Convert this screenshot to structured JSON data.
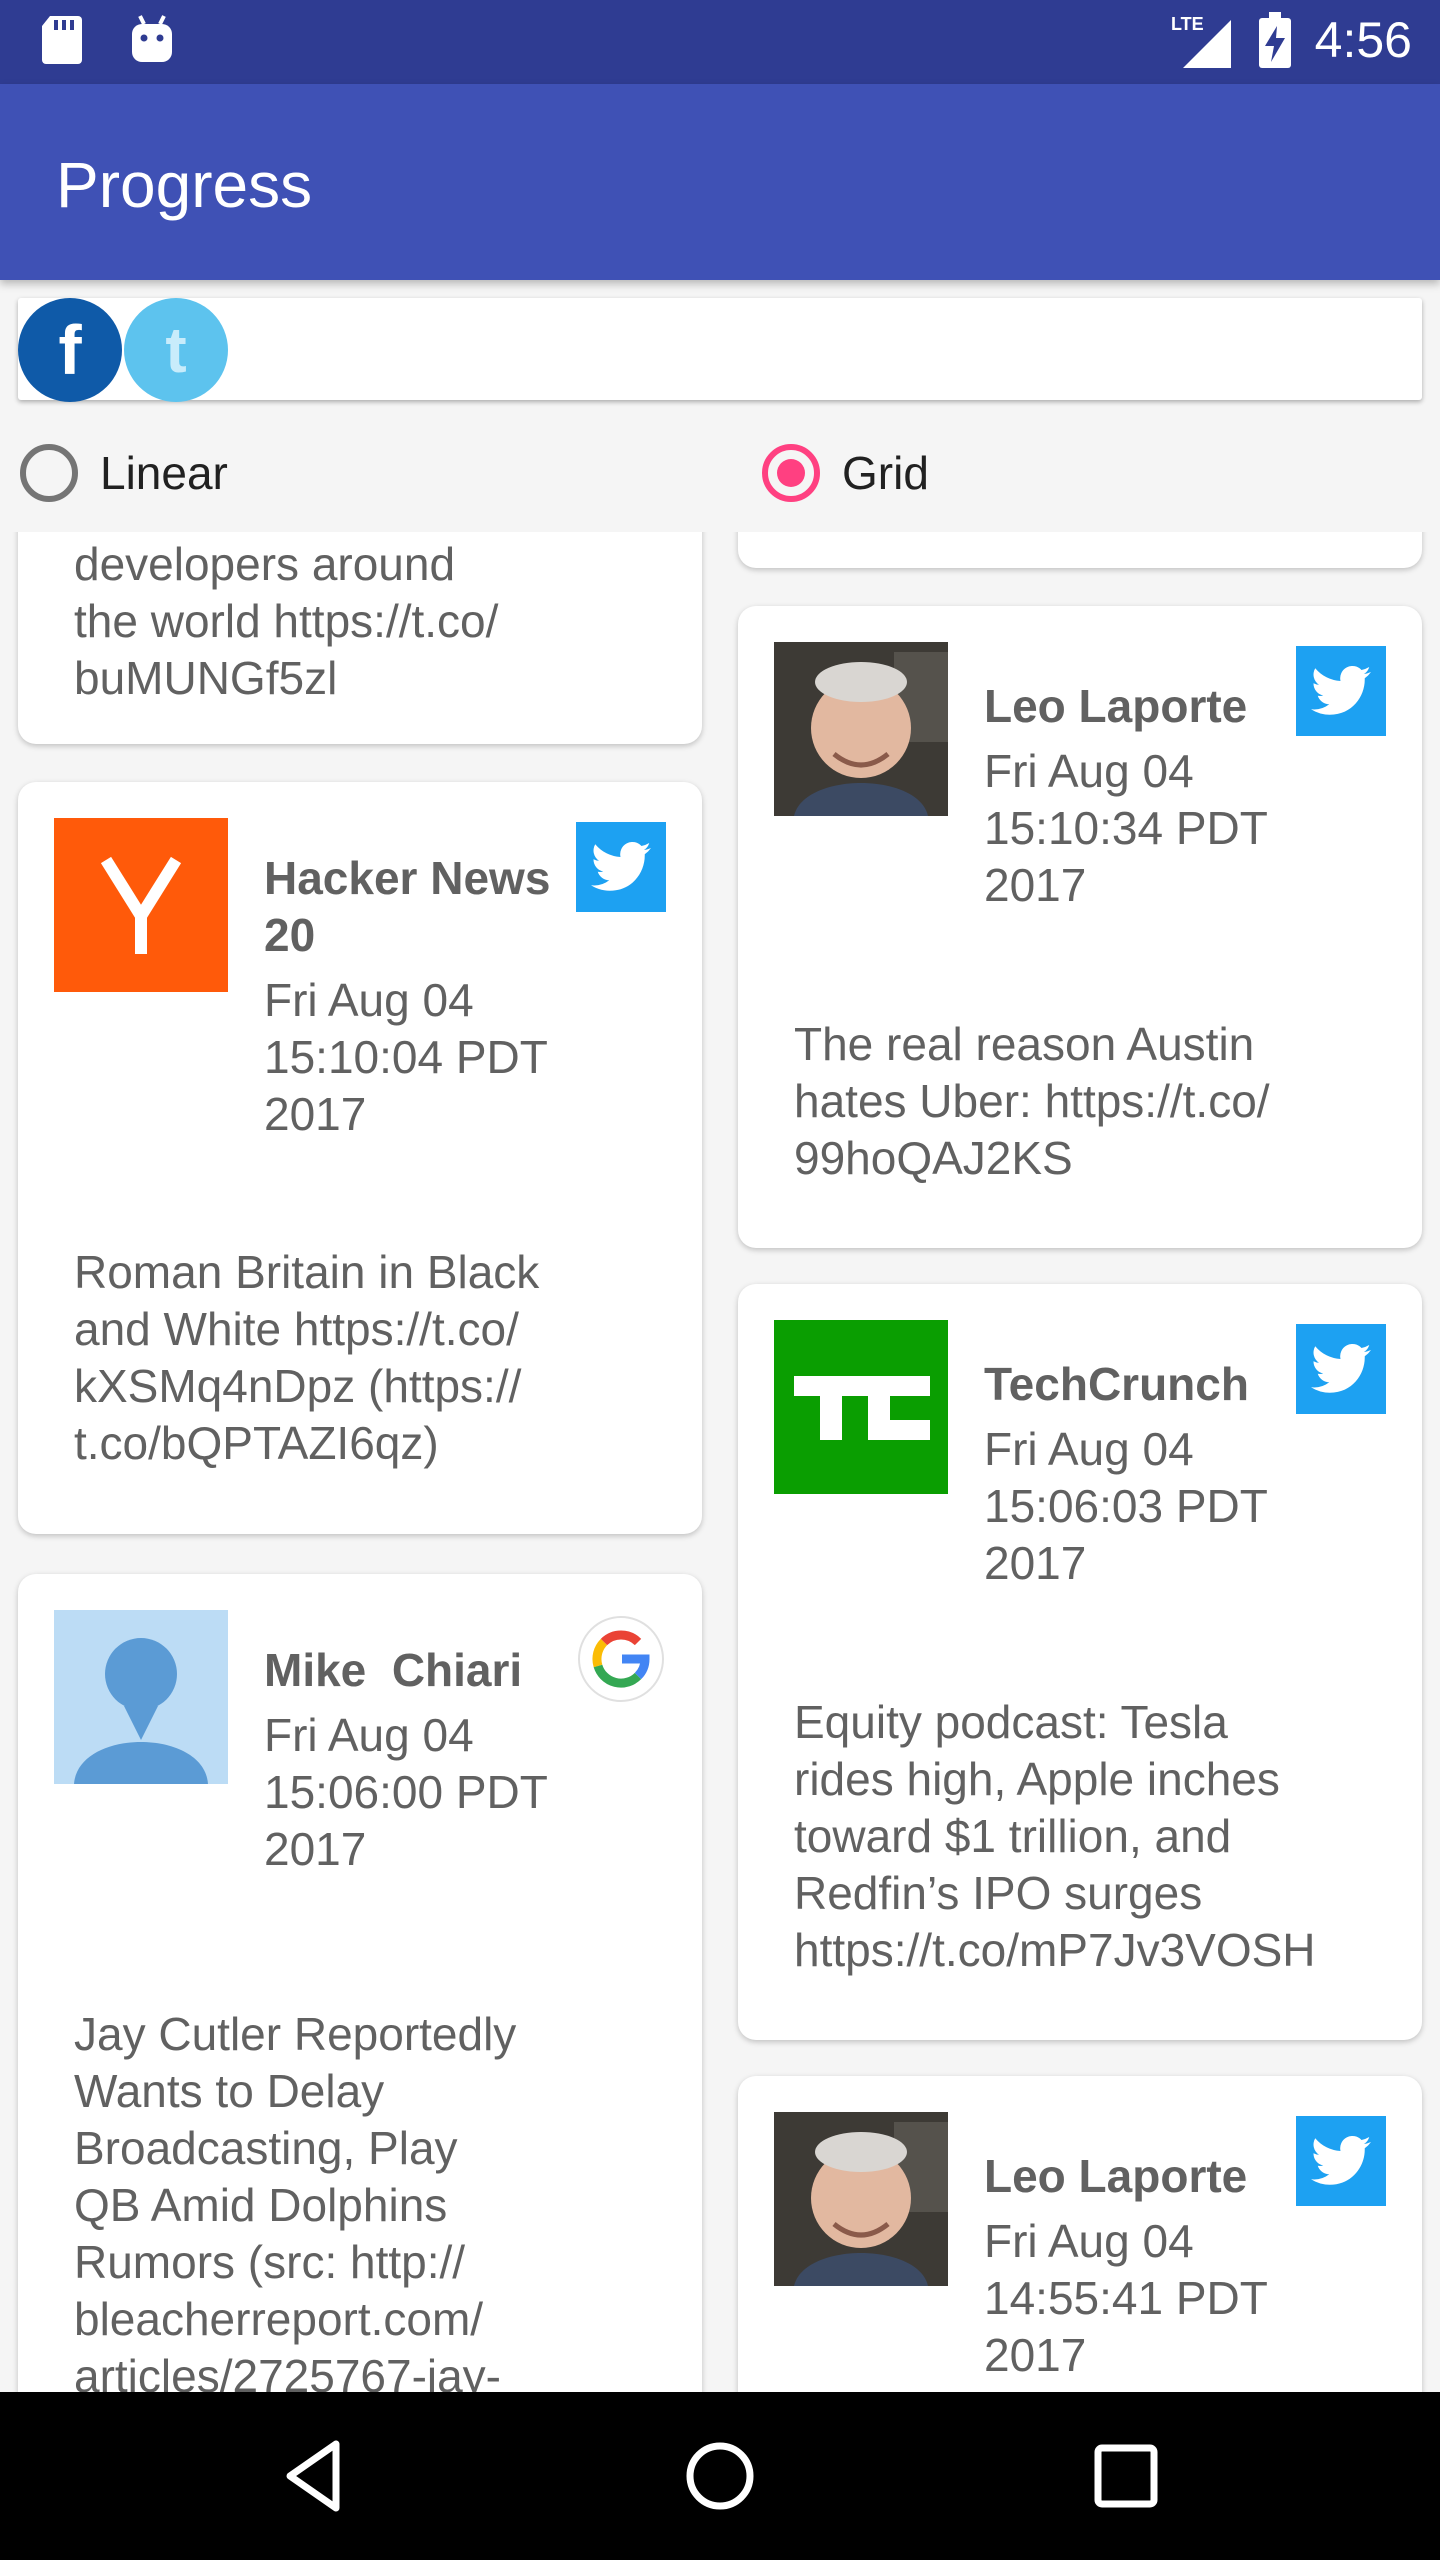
{
  "status_bar": {
    "time": "4:56",
    "network": "LTE"
  },
  "app_bar": {
    "title": "Progress"
  },
  "view_mode": {
    "linear_label": "Linear",
    "grid_label": "Grid",
    "selected": "Grid"
  },
  "feed": {
    "left": [
      {
        "partial": true,
        "text": "developers around\nthe world https://t.co/\nbuMUNGf5zl"
      },
      {
        "author": "Hacker News\n20",
        "time": "Fri Aug 04\n15:10:04 PDT\n2017",
        "source": "twitter",
        "text": "Roman Britain in Black\nand White https://t.co/\nkXSMq4nDpz (https://\nt.co/bQPTAZI6qz)"
      },
      {
        "author": "Mike  Chiari",
        "time": "Fri Aug 04\n15:06:00 PDT\n2017",
        "source": "google",
        "text": "Jay Cutler Reportedly\nWants to Delay\nBroadcasting, Play\nQB Amid Dolphins\nRumors (src: http://\nbleacherreport.com/\narticles/2725767-jay-"
      }
    ],
    "right": [
      {
        "author": "Leo Laporte",
        "time": "Fri Aug 04\n15:10:34 PDT\n2017",
        "source": "twitter",
        "text": "The real reason Austin\nhates Uber: https://t.co/\n99hoQAJ2KS"
      },
      {
        "author": "TechCrunch",
        "time": "Fri Aug 04\n15:06:03 PDT\n2017",
        "source": "twitter",
        "text": "Equity podcast: Tesla\nrides high, Apple inches\ntoward $1 trillion, and\nRedfin’s IPO surges\nhttps://t.co/mP7Jv3VOSH"
      },
      {
        "author": "Leo Laporte",
        "time": "Fri Aug 04\n14:55:41 PDT\n2017",
        "source": "twitter",
        "text": ""
      }
    ]
  },
  "colors": {
    "status_bar": "#2f3c92",
    "app_bar": "#3f51b5",
    "accent": "#ff4081",
    "twitter": "#1da1f2"
  }
}
